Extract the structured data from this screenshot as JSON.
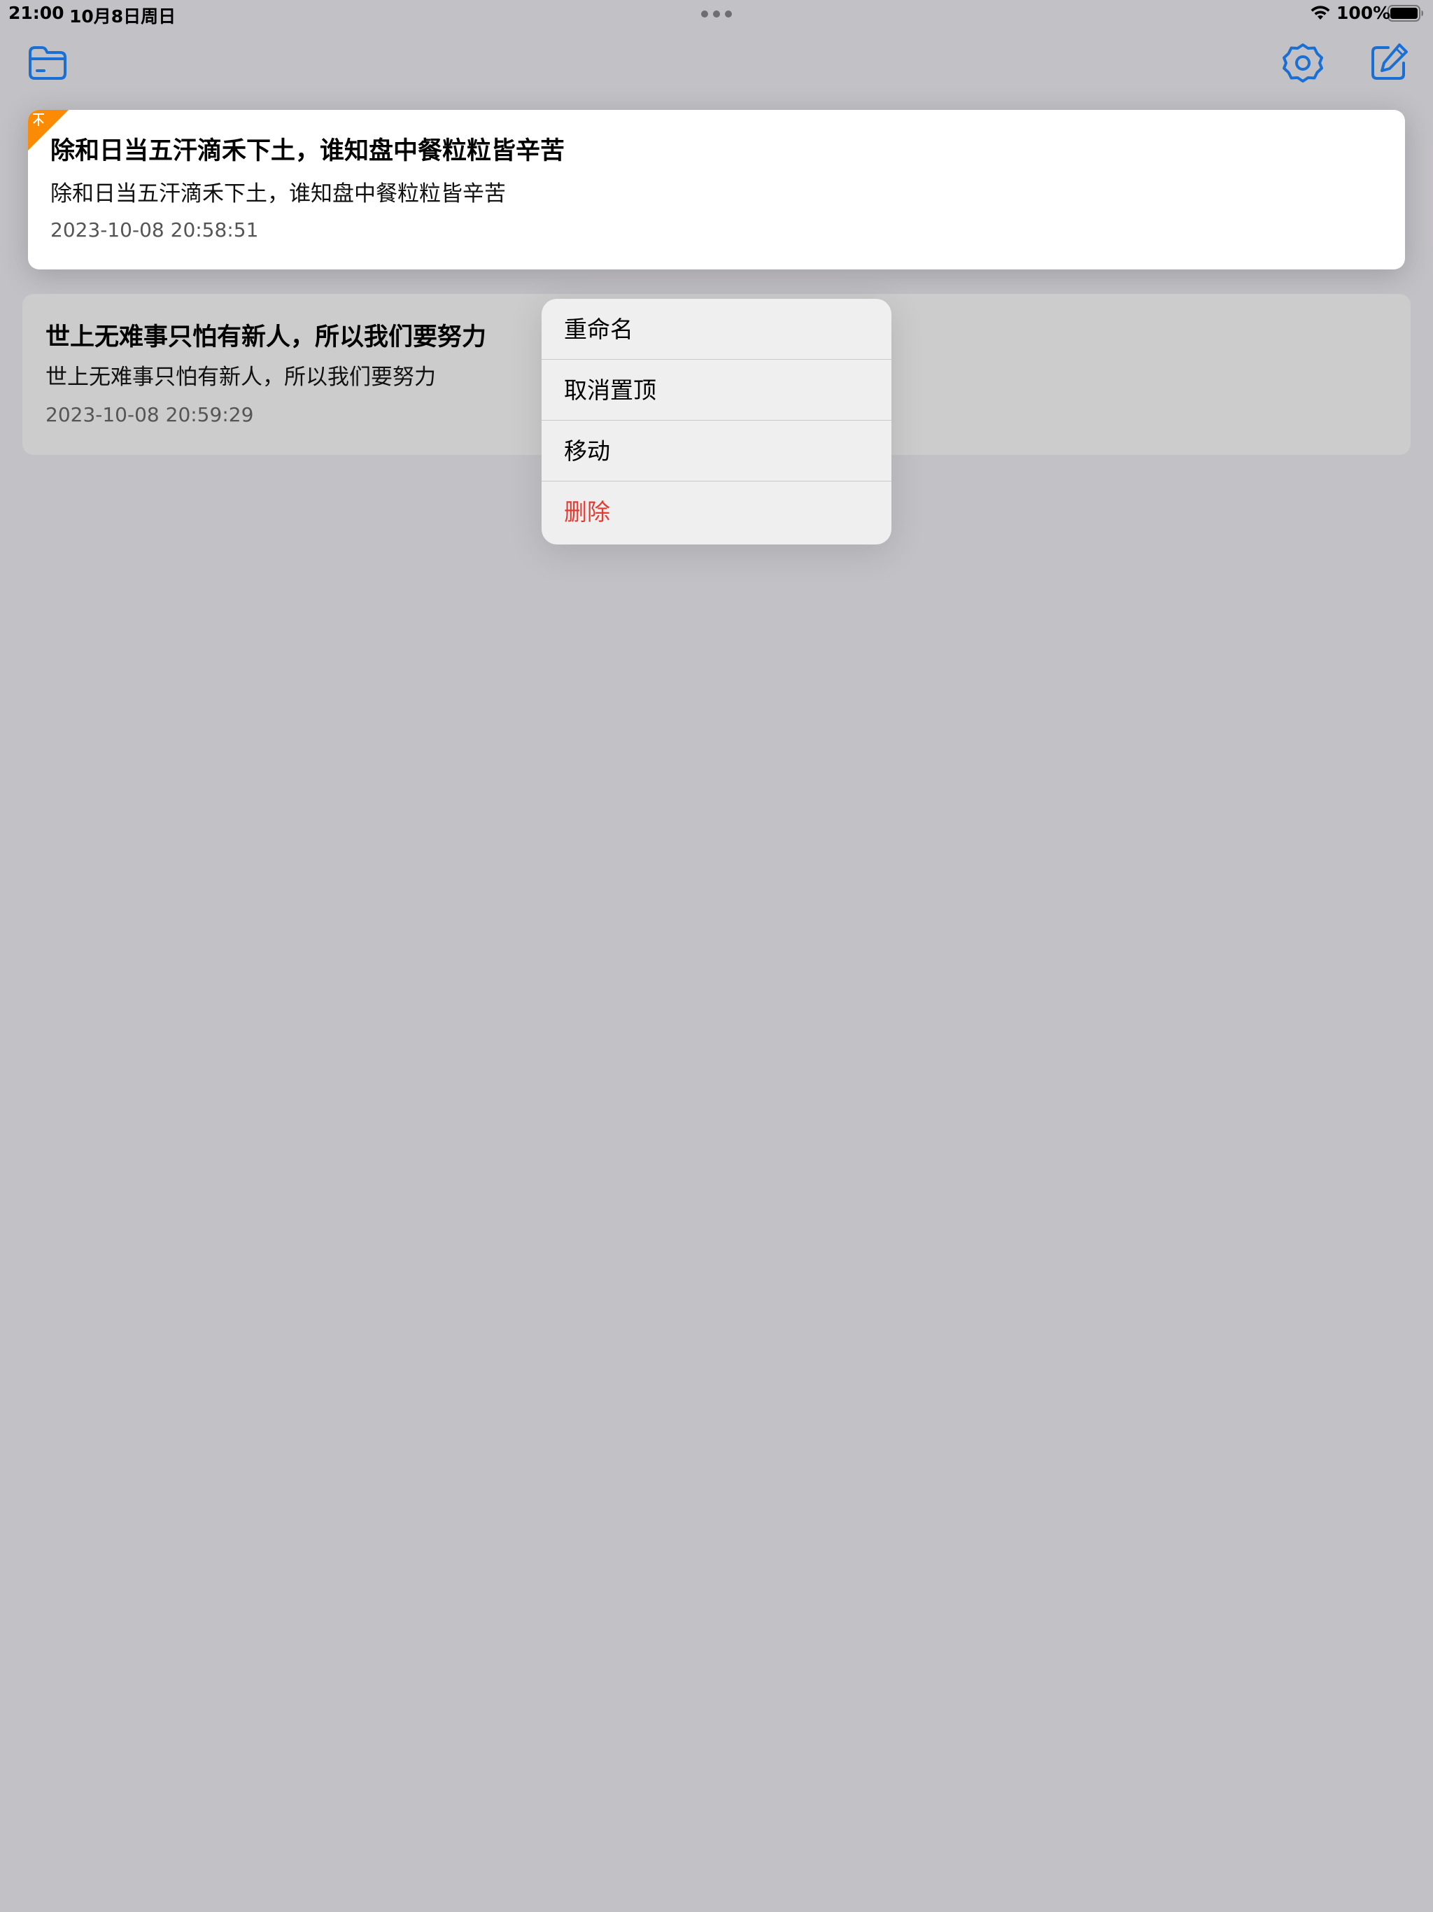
{
  "status_bar": {
    "time": "21:00",
    "date": "10月8日周日",
    "battery": "100%"
  },
  "toolbar": {
    "left_icon": "folder-icon",
    "right_icons": [
      "gear-icon",
      "compose-icon"
    ],
    "accent_color": "#1a6fd4"
  },
  "notes": [
    {
      "title": "除和日当五汗滴禾下土，谁知盘中餐粒粒皆辛苦",
      "preview": "除和日当五汗滴禾下土，谁知盘中餐粒粒皆辛苦",
      "timestamp": "2023-10-08 20:58:51",
      "pinned": true,
      "pin_badge_color": "#fb8a05"
    },
    {
      "title": "世上无难事只怕有新人，所以我们要努力",
      "preview": "世上无难事只怕有新人，所以我们要努力",
      "timestamp": "2023-10-08 20:59:29",
      "pinned": false
    }
  ],
  "context_menu": {
    "items": [
      {
        "label": "重命名"
      },
      {
        "label": "取消置顶"
      },
      {
        "label": "移动"
      },
      {
        "label": "删除",
        "destructive": true,
        "color": "#e23b32"
      }
    ]
  }
}
